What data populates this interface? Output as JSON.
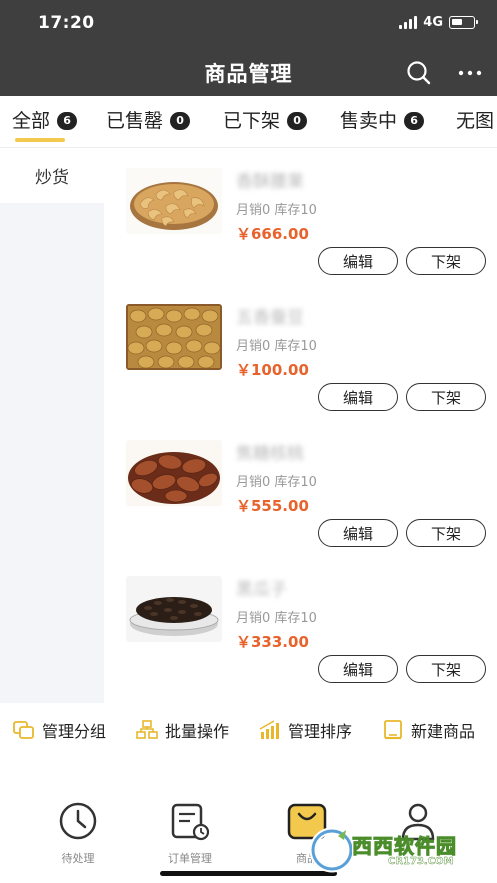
{
  "status_bar": {
    "time": "17:20",
    "network": "4G"
  },
  "nav": {
    "title": "商品管理"
  },
  "tabs": [
    {
      "label": "全部",
      "count": "6"
    },
    {
      "label": "已售罄",
      "count": "0"
    },
    {
      "label": "已下架",
      "count": "0"
    },
    {
      "label": "售卖中",
      "count": "6"
    },
    {
      "label": "无图",
      "count": ""
    }
  ],
  "sidebar": {
    "items": [
      {
        "label": "炒货"
      }
    ]
  },
  "products": [
    {
      "name": "香酥腰果",
      "stats": "月销0  库存10",
      "price": "￥666.00",
      "edit_label": "编辑",
      "delist_label": "下架"
    },
    {
      "name": "五香蚕豆",
      "stats": "月销0  库存10",
      "price": "￥100.00",
      "edit_label": "编辑",
      "delist_label": "下架"
    },
    {
      "name": "焦糖核桃",
      "stats": "月销0  库存10",
      "price": "￥555.00",
      "edit_label": "编辑",
      "delist_label": "下架"
    },
    {
      "name": "黑瓜子",
      "stats": "月销0  库存10",
      "price": "￥333.00",
      "edit_label": "编辑",
      "delist_label": "下架"
    }
  ],
  "actions": [
    {
      "label": "管理分组",
      "icon": "group-icon"
    },
    {
      "label": "批量操作",
      "icon": "batch-icon"
    },
    {
      "label": "管理排序",
      "icon": "sort-icon"
    },
    {
      "label": "新建商品",
      "icon": "new-product-icon"
    }
  ],
  "bottom_tabs": [
    {
      "label": "待处理",
      "icon": "clock-icon"
    },
    {
      "label": "订单管理",
      "icon": "order-icon"
    },
    {
      "label": "商品",
      "icon": "bag-icon",
      "active": true
    },
    {
      "label": "",
      "icon": "person-icon"
    }
  ],
  "watermark": {
    "main": "西西软件园",
    "sub": "CR173.COM"
  },
  "colors": {
    "header": "#3f3f3f",
    "accent": "#f2c94c",
    "price": "#e8622c"
  }
}
